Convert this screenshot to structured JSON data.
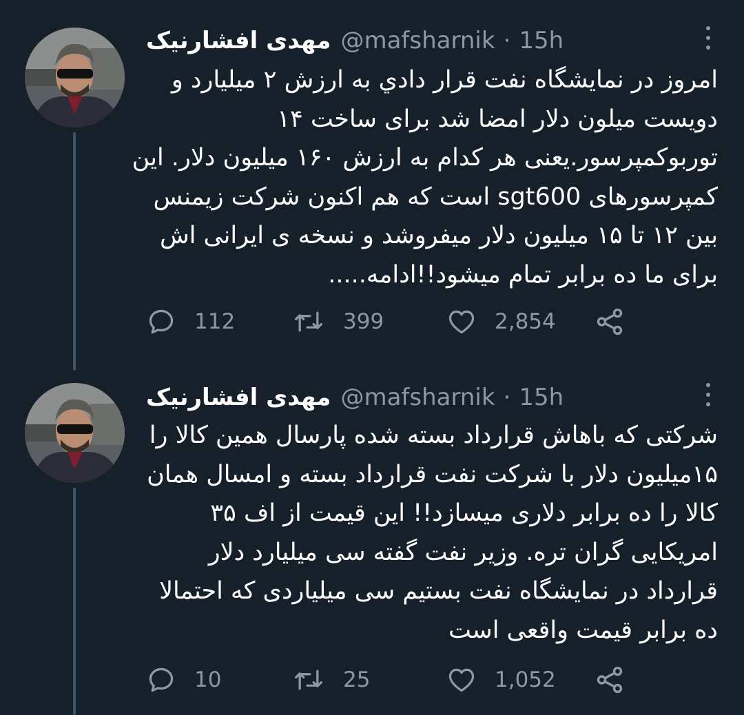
{
  "tweets": [
    {
      "author": {
        "name": "مهدی افشارنیک",
        "handle": "@mafsharnik",
        "separator": "·",
        "time": "15h"
      },
      "text_lines": [
        "امروز در نمایشگاه نفت قرار دادي به ارزش ۲ ميليارد و",
        "دویست میلون دلار امضا شد برای ساخت ۱۴",
        "توربوکمپرسور.یعنی هر کدام به ارزش ۱۶۰ میلیون دلار. این",
        "کمپرسورهای sgt600 است که هم اکنون شرکت زیمنس",
        "بین ۱۲ تا ۱۵ میلیون دلار میفروشد و نسخه ی ایرانی اش",
        "برای ما ده برابر تمام میشود!!ادامه....."
      ],
      "stats": {
        "replies": "112",
        "retweets": "399",
        "likes": "2,854"
      }
    },
    {
      "author": {
        "name": "مهدی افشارنیک",
        "handle": "@mafsharnik",
        "separator": "·",
        "time": "15h"
      },
      "text_lines": [
        "شرکتی که باهاش قرارداد بسته شده پارسال همین کالا را",
        "۱۵میلیون دلار با شرکت نفت قرارداد بسته و امسال همان",
        "کالا را ده برابر دلاری میسازد!! این قیمت از اف ۳۵",
        "امریکایی گران تره. وزیر نفت گفته سی میلیارد دلار",
        "قرارداد در نمایشگاه نفت بستیم سی میلیاردی که احتمالا",
        "ده برابر قیمت واقعی است"
      ],
      "stats": {
        "replies": "10",
        "retweets": "25",
        "likes": "1,052"
      }
    }
  ],
  "icons": {
    "reply": "reply-icon",
    "retweet": "retweet-icon",
    "like": "heart-icon",
    "share": "share-icon",
    "more": "more-options-icon"
  },
  "colors": {
    "background": "#15202b",
    "text": "#ffffff",
    "secondary": "#8b98a5",
    "thread_line": "#3d5466"
  }
}
